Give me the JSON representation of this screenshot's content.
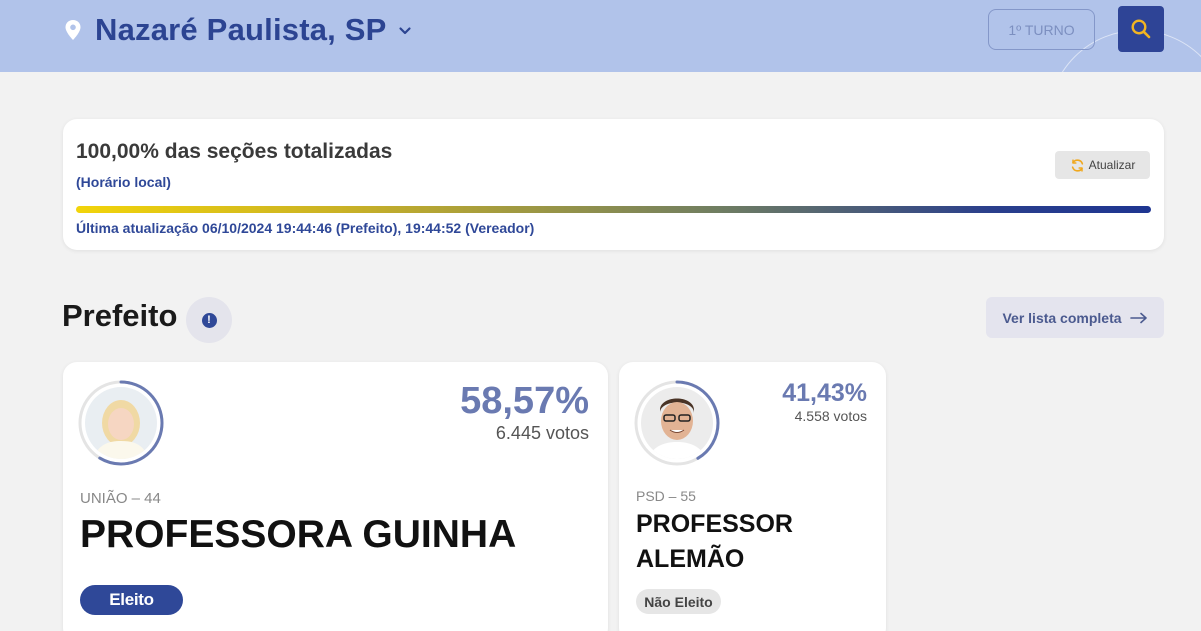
{
  "header": {
    "location": "Nazaré Paulista, SP",
    "round_label": "1º TURNO",
    "icons": {
      "location": "map-pin-icon",
      "dropdown": "chevron-down-icon",
      "search": "search-icon"
    }
  },
  "status": {
    "title": "100,00% das seções totalizadas",
    "subtitle": "(Horário local)",
    "refresh_label": "Atualizar",
    "progress": 1.0,
    "last_update": "Última atualização 06/10/2024 19:44:46 (Prefeito), 19:44:52 (Vereador)"
  },
  "section": {
    "title": "Prefeito",
    "full_list_label": "Ver lista completa"
  },
  "candidates": [
    {
      "percent": "58,57%",
      "percent_value": 58.57,
      "votes": "6.445 votos",
      "party": "UNIÃO – 44",
      "name": "PROFESSORA GUINHA",
      "status": "Eleito"
    },
    {
      "percent": "41,43%",
      "percent_value": 41.43,
      "votes": "4.558 votos",
      "party": "PSD – 55",
      "name_line1": "PROFESSOR",
      "name_line2": "ALEMÃO",
      "status": "Não Eleito"
    }
  ],
  "colors": {
    "topbar": "#b1c3ea",
    "brand_blue": "#2f4898",
    "percent_text": "#6a7ab1",
    "progress_start": "#f2d40a",
    "progress_end": "#1e3591"
  }
}
